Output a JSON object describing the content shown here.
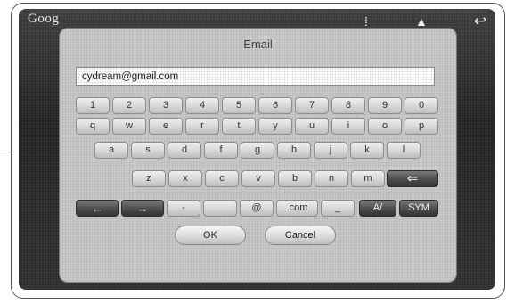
{
  "screen": {
    "logo": "Goog",
    "status_icons": [
      "signal-icon",
      "home-icon",
      "back-icon"
    ]
  },
  "dialog": {
    "title": "Email",
    "input_value": "cydream@gmail.com",
    "ok_label": "OK",
    "cancel_label": "Cancel"
  },
  "keyboard": {
    "row1": [
      "1",
      "2",
      "3",
      "4",
      "5",
      "6",
      "7",
      "8",
      "9",
      "0"
    ],
    "row2": [
      "q",
      "w",
      "e",
      "r",
      "t",
      "y",
      "u",
      "i",
      "o",
      "p"
    ],
    "row3": [
      "a",
      "s",
      "d",
      "f",
      "g",
      "h",
      "j",
      "k",
      "l"
    ],
    "row4": [
      "z",
      "x",
      "c",
      "v",
      "b",
      "n",
      "m"
    ],
    "backspace_glyph": "⇐",
    "left_arrow": "←",
    "right_arrow": "→",
    "dash": "-",
    "space": "",
    "at": "@",
    "dotcom": ".com",
    "underscore": "_",
    "case_toggle": "A/",
    "sym": "SYM"
  }
}
